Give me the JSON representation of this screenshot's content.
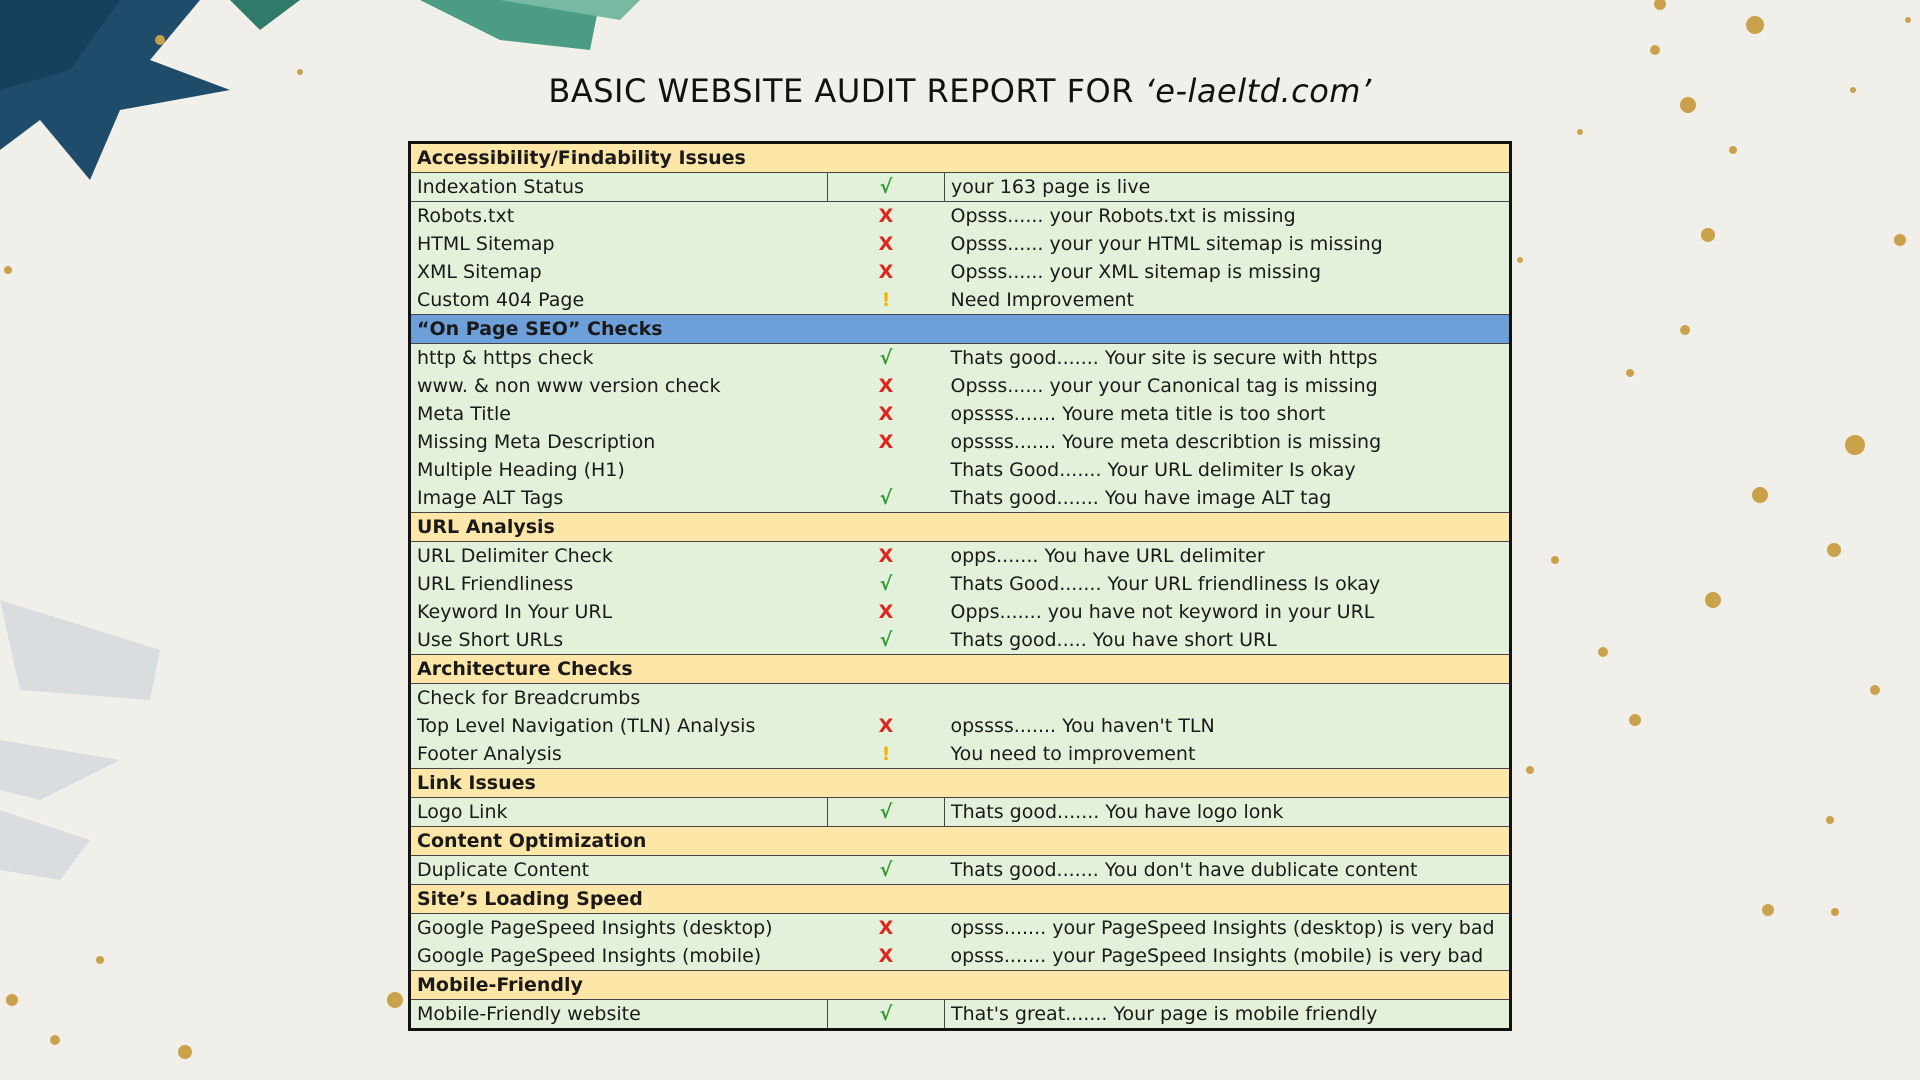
{
  "title": {
    "main": "BASIC WEBSITE AUDIT REPORT FOR ",
    "site": "‘e-laeltd.com’"
  },
  "colors": {
    "section_bg": "#fde7a8",
    "section_blue_bg": "#6d9fd8",
    "row_bg": "#e3f0da",
    "ok": "#2f9a2f",
    "fail": "#e0251b",
    "warn": "#f0b400"
  },
  "sections": [
    {
      "title": "Accessibility/Findability Issues",
      "style": "yellow",
      "rows": [
        {
          "name": "Indexation Status",
          "mark": "√",
          "status": "ok",
          "note": "your  163  page is live",
          "boxed": true
        },
        {
          "name": "Robots.txt",
          "mark": "X",
          "status": "fail",
          "note": "Opsss......  your Robots.txt is missing"
        },
        {
          "name": "HTML Sitemap",
          "mark": "X",
          "status": "fail",
          "note": "Opsss......  your your HTML sitemap is missing"
        },
        {
          "name": "XML Sitemap",
          "mark": "X",
          "status": "fail",
          "note": "Opsss......  your XML sitemap  is missing"
        },
        {
          "name": "Custom 404 Page",
          "mark": "!",
          "status": "warn",
          "note": "Need Improvement"
        }
      ]
    },
    {
      "title": "“On Page  SEO” Checks",
      "style": "blue",
      "rows": [
        {
          "name": "http & https check",
          "mark": "√",
          "status": "ok",
          "note": "Thats good....... Your site is secure with https"
        },
        {
          "name": "www. & non www version check",
          "mark": "X",
          "status": "fail",
          "note": "Opsss......  your your Canonical tag is missing"
        },
        {
          "name": "Meta Title",
          "mark": "X",
          "status": "fail",
          "note": "opssss....... Youre meta title is too short"
        },
        {
          "name": "Missing Meta Description",
          "mark": "X",
          "status": "fail",
          "note": "opssss....... Youre meta describtion is missing"
        },
        {
          "name": "Multiple Heading (H1)",
          "mark": "",
          "status": "none",
          "note": "Thats Good....... Your URL delimiter Is okay"
        },
        {
          "name": "Image ALT Tags",
          "mark": "√",
          "status": "ok",
          "note": "Thats good....... You have image ALT tag"
        }
      ]
    },
    {
      "title": "URL Analysis",
      "style": "yellow",
      "rows": [
        {
          "name": "URL Delimiter Check",
          "mark": "X",
          "status": "fail",
          "note": "opps....... You have URL delimiter"
        },
        {
          "name": "URL Friendliness",
          "mark": "√",
          "status": "ok",
          "note": "Thats Good....... Your URL friendliness  Is okay"
        },
        {
          "name": "Keyword In Your URL",
          "mark": "X",
          "status": "fail",
          "note": "Opps....... you have not keyword in your URL"
        },
        {
          "name": "Use Short URLs",
          "mark": "√",
          "status": "ok",
          "note": "Thats good..... You have short URL"
        }
      ]
    },
    {
      "title": "Architecture Checks",
      "style": "yellow",
      "rows": [
        {
          "name": "Check for Breadcrumbs",
          "mark": "",
          "status": "none",
          "note": ""
        },
        {
          "name": "Top Level Navigation (TLN) Analysis",
          "mark": "X",
          "status": "fail",
          "note": "opssss....... You haven't TLN"
        },
        {
          "name": "Footer Analysis",
          "mark": "!",
          "status": "warn",
          "note": "You need to improvement"
        }
      ]
    },
    {
      "title": "Link Issues",
      "style": "yellow",
      "rows": [
        {
          "name": "Logo Link",
          "mark": "√",
          "status": "ok",
          "note": "Thats good....... You have logo lonk",
          "boxed": true
        }
      ]
    },
    {
      "title": "Content Optimization",
      "style": "yellow",
      "rows": [
        {
          "name": "Duplicate Content",
          "mark": "√",
          "status": "ok",
          "note": "Thats good....... You don't have dublicate content"
        }
      ]
    },
    {
      "title": "Site’s Loading Speed",
      "style": "yellow",
      "rows": [
        {
          "name": "Google PageSpeed Insights (desktop)",
          "mark": "X",
          "status": "fail",
          "note": "opsss....... your PageSpeed Insights (desktop) is very bad"
        },
        {
          "name": "Google PageSpeed Insights (mobile)",
          "mark": "X",
          "status": "fail",
          "note": "opsss....... your PageSpeed Insights (mobile)  is very bad"
        }
      ]
    },
    {
      "title": "Mobile-Friendly",
      "style": "yellow",
      "rows": [
        {
          "name": "Mobile-Friendly website",
          "mark": "√",
          "status": "ok",
          "note": "That's great....... Your page is mobile friendly",
          "boxed": true
        }
      ]
    }
  ]
}
